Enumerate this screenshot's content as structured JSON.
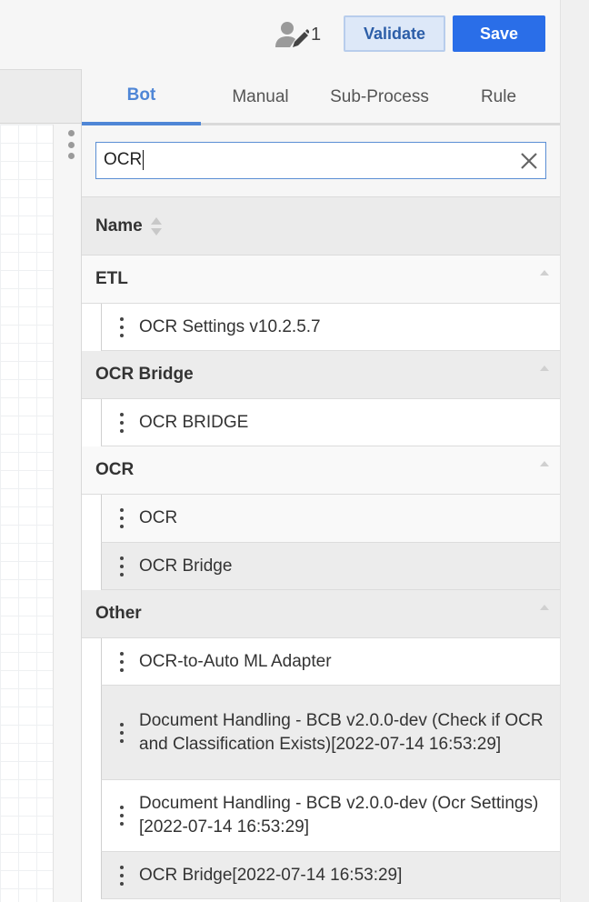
{
  "toolbar": {
    "presence_count": "1",
    "validate_label": "Validate",
    "save_label": "Save",
    "accent_color": "#2a6ee8"
  },
  "tabs": [
    {
      "label": "Bot",
      "active": true
    },
    {
      "label": "Manual",
      "active": false
    },
    {
      "label": "Sub-Process",
      "active": false
    },
    {
      "label": "Rule",
      "active": false
    }
  ],
  "search": {
    "value": "OCR",
    "clear_icon": "close-icon"
  },
  "table": {
    "column_header": "Name",
    "sort_icon": "sort-icon"
  },
  "groups": [
    {
      "label": "ETL",
      "items": [
        "OCR Settings v10.2.5.7"
      ]
    },
    {
      "label": "OCR Bridge",
      "items": [
        "OCR BRIDGE"
      ]
    },
    {
      "label": "OCR",
      "items": [
        "OCR",
        "OCR Bridge"
      ]
    },
    {
      "label": "Other",
      "items": [
        "OCR-to-Auto ML Adapter",
        "Document Handling - BCB v2.0.0-dev (Check if OCR and Classification Exists)[2022-07-14 16:53:29]",
        "Document Handling - BCB v2.0.0-dev (Ocr Settings)[2022-07-14 16:53:29]",
        "OCR Bridge[2022-07-14 16:53:29]"
      ]
    }
  ]
}
